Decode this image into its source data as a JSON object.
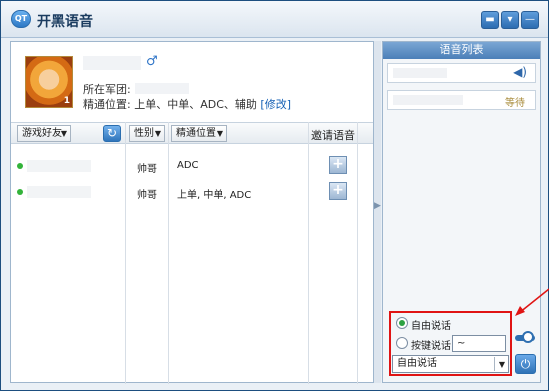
{
  "window": {
    "title": "开黑语音"
  },
  "titlebar": {
    "logo_text": "QT",
    "btn_chat": "▬",
    "btn_menu": "▾",
    "btn_minimize": "—"
  },
  "profile": {
    "gender_symbol": "♂",
    "level": "1",
    "team_label": "所在军团:",
    "position_label": "精通位置:",
    "positions": "上单、中单、ADC、辅助",
    "edit_link": "[修改]"
  },
  "friends_table": {
    "filter_label": "游戏好友",
    "gender_col": "性别",
    "position_col": "精通位置",
    "invite_col": "邀请语音",
    "rows": [
      {
        "gender": "帅哥",
        "positions": "ADC"
      },
      {
        "gender": "帅哥",
        "positions": "上单, 中单, ADC"
      }
    ]
  },
  "voice_panel": {
    "title": "语音列表",
    "status_waiting": "等待"
  },
  "talk_settings": {
    "free_talk": "自由说话",
    "push_to_talk": "按键说话",
    "hotkey_value": "~",
    "mode_value": "自由说话"
  },
  "colors": {
    "annotation": "#e01414",
    "online": "#33b33a"
  }
}
